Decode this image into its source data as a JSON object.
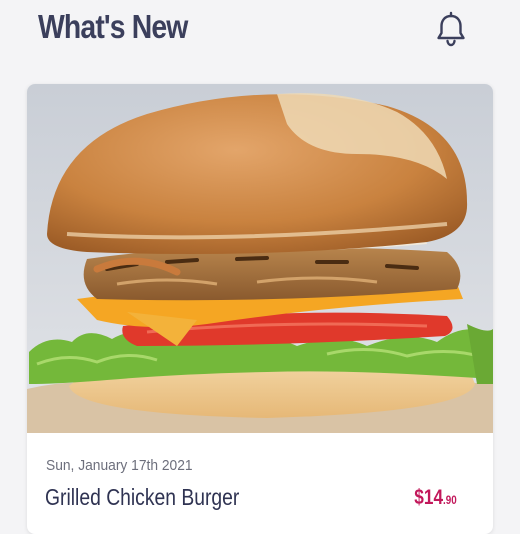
{
  "header": {
    "title": "What's New",
    "notification_icon": "bell-icon"
  },
  "feature_card": {
    "image_alt": "Grilled chicken burger photo",
    "date": "Sun, January 17th 2021",
    "name": "Grilled Chicken Burger",
    "price": {
      "currency": "$",
      "whole": "14",
      "cents": ".90"
    }
  },
  "colors": {
    "background": "#f4f4f6",
    "title": "#3b3f5c",
    "price_accent": "#c2185b"
  }
}
